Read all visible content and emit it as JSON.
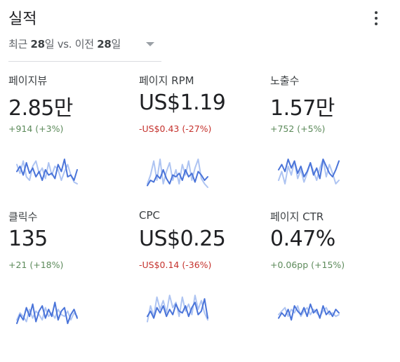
{
  "header": {
    "title": "실적"
  },
  "period": {
    "prefix": "최근 ",
    "current_days": "28",
    "middle": "일 vs. 이전 ",
    "previous_days": "28",
    "suffix": "일"
  },
  "icons": {
    "menu": "more-vert-icon",
    "dropdown": "arrow-drop-down-icon"
  },
  "colors": {
    "positive": "#5c8a5a",
    "negative": "#c5322d",
    "current_series": "#4a74d9",
    "previous_series": "#aec4f2"
  },
  "metrics": [
    {
      "label": "페이지뷰",
      "value": "2.85만",
      "change": "+914 (+3%)",
      "trend": "positive",
      "current": [
        0.55,
        0.7,
        0.45,
        0.8,
        0.5,
        0.65,
        0.4,
        0.55,
        0.3,
        0.6,
        0.45,
        0.5,
        0.35,
        0.75,
        0.55,
        0.9,
        0.4,
        0.45,
        0.3,
        0.6
      ],
      "previous": [
        0.75,
        0.5,
        0.85,
        0.4,
        0.3,
        0.7,
        0.85,
        0.5,
        0.65,
        0.35,
        0.8,
        0.45,
        0.7,
        0.6,
        0.3,
        0.55,
        0.75,
        0.45,
        0.25,
        0.2
      ]
    },
    {
      "label": "페이지 RPM",
      "value": "US$1.19",
      "change": "-US$0.43 (-27%)",
      "trend": "negative",
      "current": [
        0.15,
        0.3,
        0.25,
        0.45,
        0.35,
        0.6,
        0.35,
        0.2,
        0.45,
        0.4,
        0.5,
        0.3,
        0.6,
        0.4,
        0.5,
        0.25,
        0.55,
        0.45,
        0.3,
        0.4
      ],
      "previous": [
        0.2,
        0.45,
        0.85,
        0.3,
        0.9,
        0.2,
        0.55,
        0.8,
        0.3,
        0.6,
        0.2,
        0.75,
        0.45,
        0.85,
        0.3,
        0.65,
        0.9,
        0.35,
        0.2,
        0.1
      ]
    },
    {
      "label": "노출수",
      "value": "1.57만",
      "change": "+752 (+5%)",
      "trend": "positive",
      "current": [
        0.6,
        0.75,
        0.55,
        0.9,
        0.65,
        0.85,
        0.5,
        0.7,
        0.4,
        0.55,
        0.8,
        0.45,
        0.65,
        0.35,
        0.9,
        0.7,
        0.5,
        0.4,
        0.6,
        0.85
      ],
      "previous": [
        0.3,
        0.55,
        0.2,
        0.7,
        0.45,
        0.85,
        0.35,
        0.6,
        0.25,
        0.5,
        0.8,
        0.55,
        0.3,
        0.65,
        0.9,
        0.4,
        0.75,
        0.5,
        0.2,
        0.3
      ]
    },
    {
      "label": "클릭수",
      "value": "135",
      "change": "+21 (+18%)",
      "trend": "positive",
      "current": [
        0.1,
        0.35,
        0.2,
        0.55,
        0.3,
        0.65,
        0.15,
        0.45,
        0.6,
        0.25,
        0.5,
        0.3,
        0.7,
        0.2,
        0.45,
        0.55,
        0.1,
        0.35,
        0.5,
        0.25
      ],
      "previous": [
        0.2,
        0.4,
        0.3,
        0.15,
        0.5,
        0.25,
        0.45,
        0.35,
        0.2,
        0.55,
        0.3,
        0.4,
        0.25,
        0.5,
        0.35,
        0.3,
        0.45,
        0.2,
        0.4,
        0.3
      ]
    },
    {
      "label": "CPC",
      "value": "US$0.25",
      "change": "-US$0.14 (-36%)",
      "trend": "negative",
      "current": [
        0.3,
        0.45,
        0.25,
        0.55,
        0.4,
        0.6,
        0.3,
        0.5,
        0.35,
        0.65,
        0.45,
        0.4,
        0.6,
        0.3,
        0.55,
        0.7,
        0.35,
        0.45,
        0.8,
        0.25
      ],
      "previous": [
        0.15,
        0.6,
        0.3,
        0.85,
        0.5,
        0.75,
        0.4,
        0.9,
        0.55,
        0.7,
        0.3,
        0.85,
        0.45,
        0.65,
        0.35,
        0.9,
        0.5,
        0.75,
        0.4,
        0.2
      ]
    },
    {
      "label": "페이지 CTR",
      "value": "0.47%",
      "change": "+0.06pp (+15%)",
      "trend": "positive",
      "current": [
        0.25,
        0.4,
        0.3,
        0.5,
        0.2,
        0.6,
        0.45,
        0.35,
        0.55,
        0.3,
        0.65,
        0.4,
        0.5,
        0.25,
        0.6,
        0.35,
        0.45,
        0.3,
        0.5,
        0.4
      ],
      "previous": [
        0.35,
        0.45,
        0.55,
        0.3,
        0.5,
        0.4,
        0.6,
        0.3,
        0.45,
        0.55,
        0.35,
        0.5,
        0.4,
        0.3,
        0.45,
        0.55,
        0.35,
        0.4,
        0.3,
        0.35
      ]
    }
  ]
}
